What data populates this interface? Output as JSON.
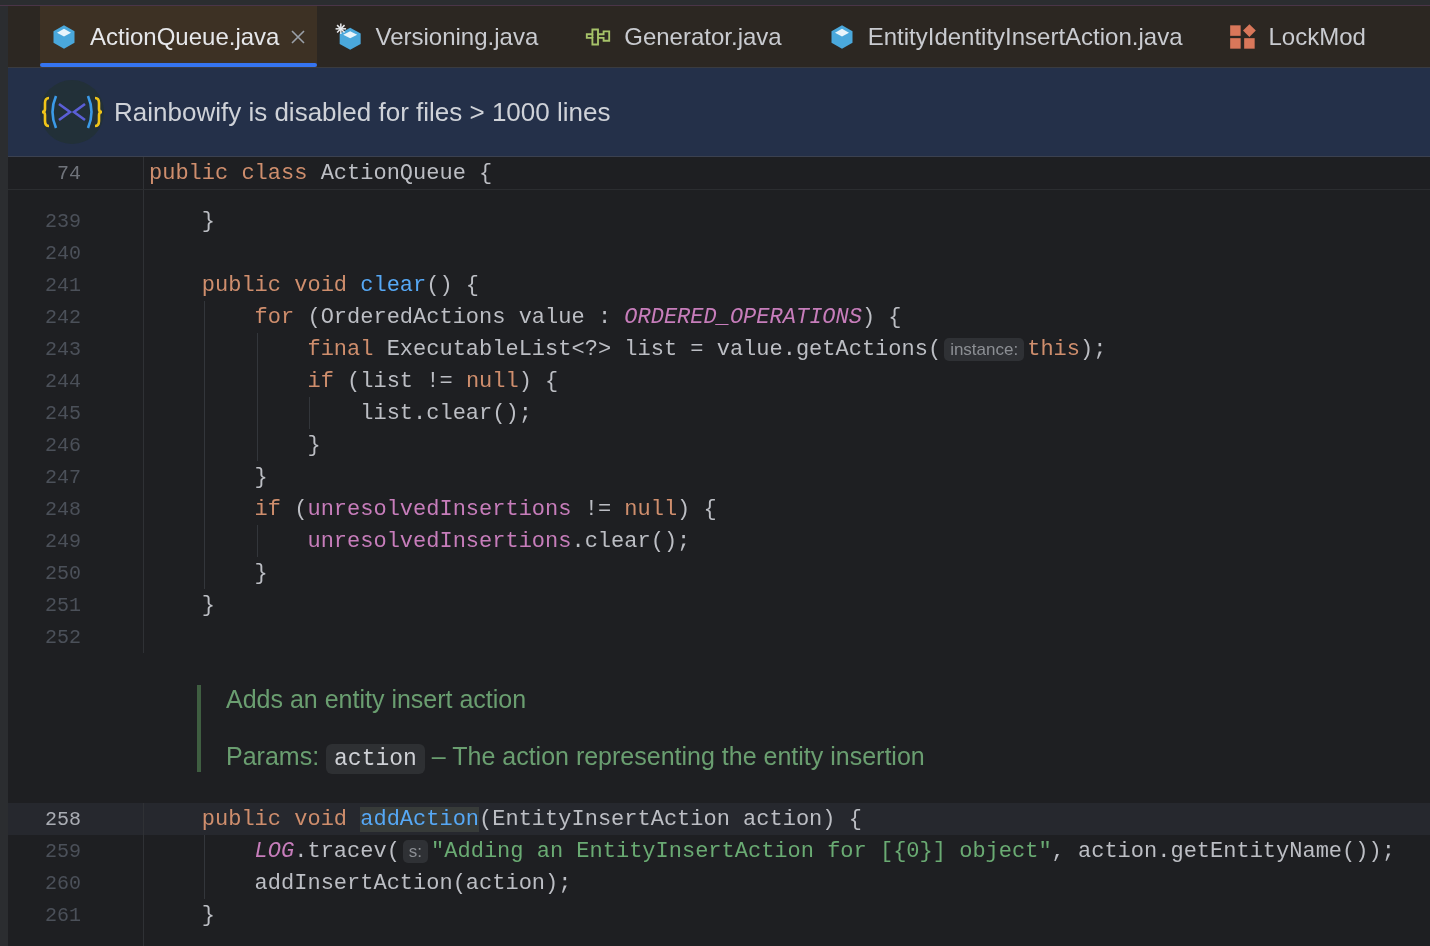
{
  "tabs": [
    {
      "label": "ActionQueue.java",
      "kind": "class",
      "selected": true,
      "closable": true
    },
    {
      "label": "Versioning.java",
      "kind": "class-config",
      "selected": false,
      "closable": false
    },
    {
      "label": "Generator.java",
      "kind": "interface",
      "selected": false,
      "closable": false
    },
    {
      "label": "EntityIdentityInsertAction.java",
      "kind": "class",
      "selected": false,
      "closable": false
    },
    {
      "label": "LockMod",
      "kind": "enum",
      "selected": false,
      "closable": false
    }
  ],
  "banner": {
    "text": "Rainbowify is disabled for files > 1000 lines"
  },
  "sticky_header": {
    "number": "74",
    "tokens": [
      {
        "text": "public class ",
        "kind": "keyword"
      },
      {
        "text": "ActionQueue {",
        "kind": "plain"
      }
    ]
  },
  "lines": [
    {
      "number": "239",
      "current": false,
      "tokens": [
        {
          "text": "    }",
          "kind": "plain"
        }
      ]
    },
    {
      "number": "240",
      "current": false
    },
    {
      "number": "241",
      "current": false,
      "tokens": [
        {
          "text": "    public void ",
          "kind": "keyword"
        },
        {
          "text": "clear",
          "kind": "method"
        },
        {
          "text": "() {",
          "kind": "plain"
        }
      ]
    },
    {
      "number": "242",
      "current": false,
      "tokens": [
        {
          "text": "        for ",
          "kind": "keyword"
        },
        {
          "text": "(OrderedActions value : ",
          "kind": "plain"
        },
        {
          "text": "ORDERED_OPERATIONS",
          "kind": "static"
        },
        {
          "text": ") {",
          "kind": "plain"
        }
      ]
    },
    {
      "number": "243",
      "current": false,
      "tokens": [
        {
          "text": "            final ",
          "kind": "keyword"
        },
        {
          "text": "ExecutableList<?> list = value.getActions(",
          "kind": "plain"
        },
        {
          "text": "instance:",
          "kind": "hint"
        },
        {
          "text": "this",
          "kind": "keyword"
        },
        {
          "text": ");",
          "kind": "plain"
        }
      ]
    },
    {
      "number": "244",
      "current": false,
      "tokens": [
        {
          "text": "            if ",
          "kind": "keyword"
        },
        {
          "text": "(list != ",
          "kind": "plain"
        },
        {
          "text": "null",
          "kind": "keyword"
        },
        {
          "text": ") {",
          "kind": "plain"
        }
      ]
    },
    {
      "number": "245",
      "current": false,
      "tokens": [
        {
          "text": "                list.clear();",
          "kind": "plain"
        }
      ]
    },
    {
      "number": "246",
      "current": false,
      "tokens": [
        {
          "text": "            }",
          "kind": "plain"
        }
      ]
    },
    {
      "number": "247",
      "current": false,
      "tokens": [
        {
          "text": "        }",
          "kind": "plain"
        }
      ]
    },
    {
      "number": "248",
      "current": false,
      "tokens": [
        {
          "text": "        if ",
          "kind": "keyword"
        },
        {
          "text": "(",
          "kind": "plain"
        },
        {
          "text": "unresolvedInsertions",
          "kind": "field"
        },
        {
          "text": " != ",
          "kind": "plain"
        },
        {
          "text": "null",
          "kind": "keyword"
        },
        {
          "text": ") {",
          "kind": "plain"
        }
      ]
    },
    {
      "number": "249",
      "current": false,
      "tokens": [
        {
          "text": "            unresolvedInsertions",
          "kind": "field"
        },
        {
          "text": ".clear();",
          "kind": "plain"
        }
      ]
    },
    {
      "number": "250",
      "current": false,
      "tokens": [
        {
          "text": "        }",
          "kind": "plain"
        }
      ]
    },
    {
      "number": "251",
      "current": false,
      "tokens": [
        {
          "text": "    }",
          "kind": "plain"
        }
      ]
    },
    {
      "number": "252",
      "current": false
    }
  ],
  "doc_comment": {
    "summary": "Adds an entity insert action",
    "params_label": "Params:",
    "param_name": "action",
    "param_description": "– The action representing the entity insertion"
  },
  "lines_after": [
    {
      "number": "258",
      "current": true,
      "tokens": [
        {
          "text": "    public void ",
          "kind": "keyword"
        },
        {
          "text": "addAction",
          "kind": "method-highlighted"
        },
        {
          "text": "(EntityInsertAction action) {",
          "kind": "plain"
        }
      ]
    },
    {
      "number": "259",
      "current": false,
      "tokens": [
        {
          "text": "        LOG",
          "kind": "static"
        },
        {
          "text": ".tracev(",
          "kind": "plain"
        },
        {
          "text": "s:",
          "kind": "hint"
        },
        {
          "text": "\"Adding an EntityInsertAction for [{0}] object\"",
          "kind": "string"
        },
        {
          "text": ", action.getEntityName());",
          "kind": "plain"
        }
      ]
    },
    {
      "number": "260",
      "current": false,
      "tokens": [
        {
          "text": "        addInsertAction(action);",
          "kind": "plain"
        }
      ]
    },
    {
      "number": "261",
      "current": false,
      "tokens": [
        {
          "text": "    }",
          "kind": "plain"
        }
      ]
    }
  ]
}
